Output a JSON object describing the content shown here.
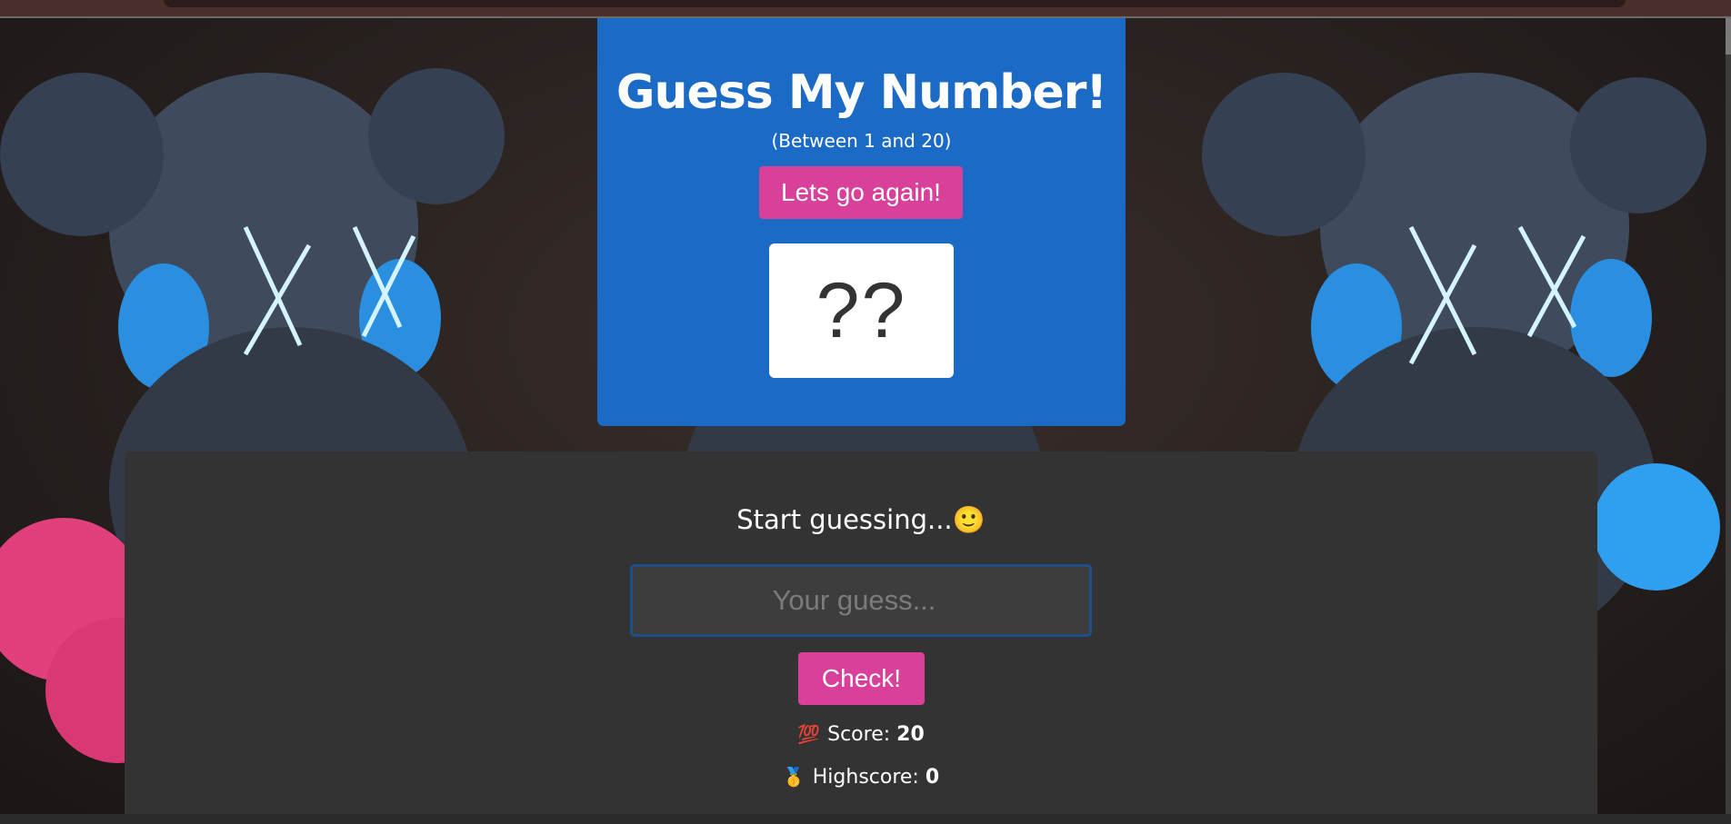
{
  "header": {
    "title": "Guess My Number!",
    "range_hint": "(Between 1 and 20)",
    "again_button_label": "Lets go again!",
    "secret_number_display": "??"
  },
  "main": {
    "message": "Start guessing...🙂",
    "guess_input": {
      "value": "",
      "placeholder": "Your guess..."
    },
    "check_button_label": "Check!",
    "score": {
      "icon": "hundred-points-icon",
      "emoji": "💯",
      "label": "Score:",
      "value": "20"
    },
    "highscore": {
      "icon": "medal-icon",
      "emoji": "🥇",
      "label": "Highscore:",
      "value": "0"
    }
  },
  "colors": {
    "header_bg": "#1a6ac6",
    "accent_button": "#d8409a",
    "panel_bg": "#333333",
    "input_border": "#1f4f86"
  }
}
